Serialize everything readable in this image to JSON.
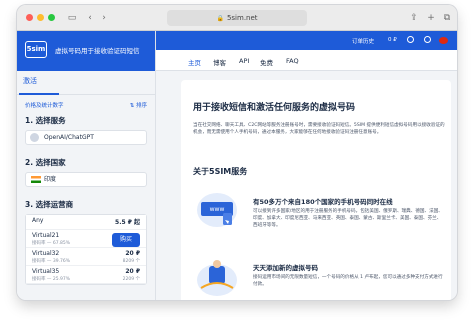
{
  "browser": {
    "url": "5sim.net"
  },
  "sidebar": {
    "logo_text": "5sim",
    "title": "虚拟号码用于接收验证码短信",
    "tab_active": "激活",
    "sort_left": "价格及统计数字",
    "sort_right": "排序",
    "step1": "1. 选择服务",
    "service": "OpenAI/ChatGPT",
    "step2": "2. 选择国家",
    "country": "印度",
    "step3": "3. 选择运营商",
    "operators": [
      {
        "name": "Any",
        "price": "5.5 ₽ 起",
        "count": "8209 个"
      },
      {
        "name": "Virtual21",
        "rate": "接码率 — 67.85%",
        "buy": "购买"
      },
      {
        "name": "Virtual32",
        "rate": "接码率 — 39.76%",
        "price": "20 ₽",
        "count": "8209 个"
      },
      {
        "name": "Virtual35",
        "rate": "接码率 — 25.97%",
        "price": "20 ₽",
        "count": "2209 个"
      }
    ]
  },
  "topnav": {
    "orders": "订单历史",
    "balance": "0 ₽"
  },
  "subnav": {
    "items": [
      "主页",
      "博客",
      "API",
      "免费",
      "FAQ"
    ]
  },
  "main": {
    "heading": "用于接收短信和激活任何服务的虚拟号码",
    "paragraph": "当在社交网络、聊天工具、C2C网站等服务注册账号时，需要接收验证码短信。5SIM 提供便利短信虚拟号码用以接收验证的机会，而无需使用个人手机号码，通过本服务，大家能够在任何地接收验证码注册任意账号。",
    "about_heading": "关于5SIM服务",
    "features": [
      {
        "title": "有50多万个来自180个国家的手机号码同时在线",
        "text": "可以接到许多国家/地区的用于注册服务的手机号码，包括美国、俄罗斯、瑞典、德国、法国、印度、加拿大、印度尼西亚、马来西亚、英国、泰国、蒙古、斯里兰卡、美国、泰国、芬兰、西班牙等等。"
      },
      {
        "title": "天天添加新的虚拟号码",
        "text": "接码运用市场间的无限数量短信，一个号码的价格从 1 卢布起，您可以通过多种支付方式进行付款。"
      }
    ]
  }
}
